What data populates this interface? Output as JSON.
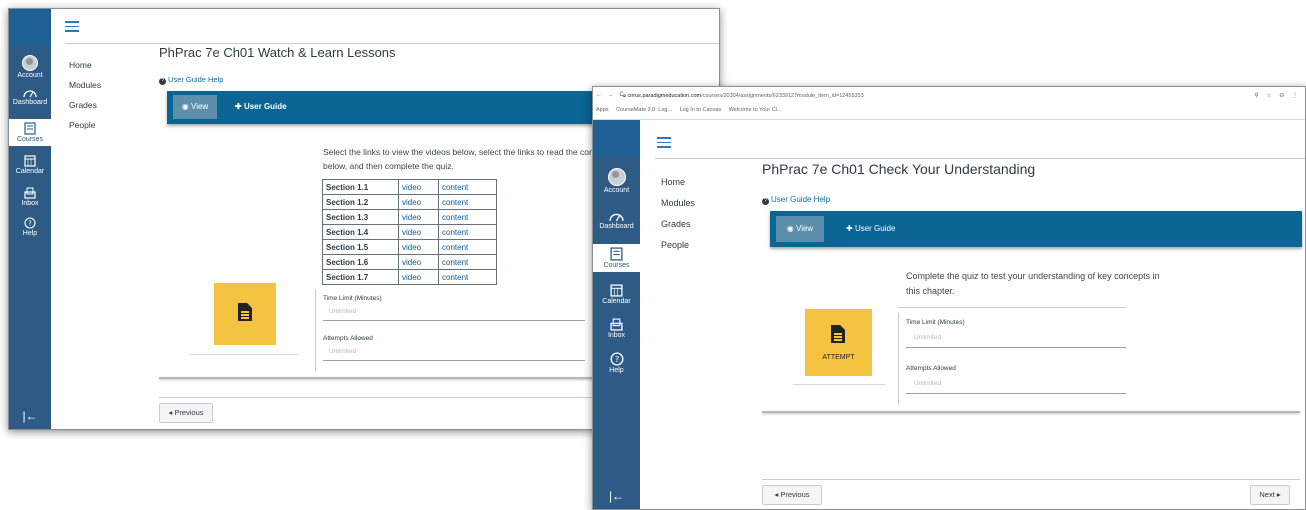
{
  "nav": {
    "account": "Account",
    "dashboard": "Dashboard",
    "courses": "Courses",
    "calendar": "Calendar",
    "inbox": "Inbox",
    "help": "Help",
    "collapse_glyph": "|←"
  },
  "course_nav": [
    "Home",
    "Modules",
    "Grades",
    "People"
  ],
  "window1": {
    "title": "PhPrac 7e Ch01 Watch & Learn Lessons",
    "user_guide_help": "User Guide Help",
    "view_label": "View",
    "user_guide_label": "User Guide",
    "description": "Select the links to view the videos below, select the links to read the content below, and then complete the quiz.",
    "sections": [
      {
        "section": "Section 1.1",
        "video": "video",
        "content": "content"
      },
      {
        "section": "Section 1.2",
        "video": "video",
        "content": "content"
      },
      {
        "section": "Section 1.3",
        "video": "video",
        "content": "content"
      },
      {
        "section": "Section 1.4",
        "video": "video",
        "content": "content"
      },
      {
        "section": "Section 1.5",
        "video": "video",
        "content": "content"
      },
      {
        "section": "Section 1.6",
        "video": "video",
        "content": "content"
      },
      {
        "section": "Section 1.7",
        "video": "video",
        "content": "content"
      }
    ],
    "time_limit_label": "Time Limit (Minutes)",
    "time_limit_value": "Unlimited",
    "attempts_label": "Attempts Allowed",
    "attempts_value": "Unlimited",
    "previous_label": "◂ Previous"
  },
  "window2": {
    "browser": {
      "nav_glyphs": "← → C",
      "url_host": "cirrus.paradigmeducation.com",
      "url_path": "/courses/20304/assignments/62339127module_item_id=12455353",
      "bookmarks": [
        "Apps",
        "CourseMate 3.0: Log...",
        "Log In to Canvas",
        "Welcome to Your Cl..."
      ],
      "right_glyphs": "⚲ ☆ ⊖ ⋮"
    },
    "title": "PhPrac 7e Ch01 Check Your Understanding",
    "user_guide_help": "User Guide Help",
    "view_label": "View",
    "user_guide_label": "User Guide",
    "description": "Complete the quiz to test your understanding of key concepts in this chapter.",
    "attempt_label": "ATTEMPT",
    "time_limit_label": "Time Limit (Minutes)",
    "time_limit_value": "Unlimited",
    "attempts_label": "Attempts Allowed",
    "attempts_value": "Unlimited",
    "previous_label": "◂ Previous",
    "next_label": "Next ▸"
  },
  "colors": {
    "rail": "#2d5b86",
    "toolbar": "#0a6494",
    "quiz_card": "#f4c33f",
    "link": "#0b5d9a"
  }
}
